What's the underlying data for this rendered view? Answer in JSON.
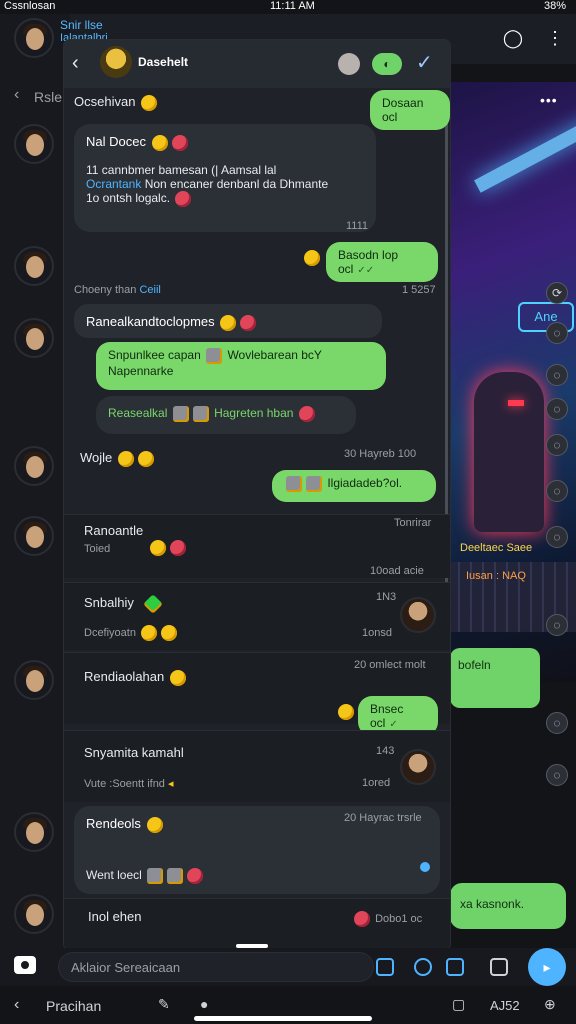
{
  "status": {
    "carrier": "Cssnlosan",
    "time": "11:11 AM",
    "battery": "38%"
  },
  "background": {
    "title": "Snir llse",
    "subtitle": "Ialantalbri",
    "back_label": "Rsle",
    "art_caption_1": "Deeltaec Saee",
    "art_caption_2": "Iusan : NAQ",
    "bubble_1": "bofeln",
    "bubble_2": "xa kasnonk."
  },
  "panel": {
    "title": "Dasehelt",
    "header_row_left": "Ocsehivan",
    "header_row_pill": "Dosaan ocl",
    "messages": [
      {
        "name": "Nal Docec",
        "body_line_1": "11  cannbmer bamesan (| Aamsal lal",
        "body_link": "Ocrantank",
        "body_line_2": " Non encaner denbanl da Dhmante",
        "body_line_3": "1o ontsh logalc.",
        "time": "1111"
      },
      {
        "out_text": "Basodn lop ocl"
      },
      {
        "meta_left": "Choeny than",
        "meta_link": "Ceiil",
        "meta_right": "1 5257"
      },
      {
        "title": "Ranealkandtoclopmes",
        "green_text_1": "Snpunlkee capan",
        "green_text_2": "Wovlebarean bcY",
        "green_text_3": "Napennarke",
        "sub_text_1": "Reasealkal",
        "sub_text_2": "Hagreten hban"
      },
      {
        "label": "Wojle",
        "time": "30 Hayreb 100"
      },
      {
        "out_text": "Ilgiadadeb?ol."
      },
      {
        "name": "Ranoantle",
        "sub": "Toied",
        "time_top": "Tonrirar",
        "time_bottom": "10oad acie"
      },
      {
        "name": "Snbalhiy",
        "sub": "Dcefiyoatn",
        "time_top": "1N3",
        "time_bottom": "1onsd"
      },
      {
        "name": "Rendiaolahan",
        "time": "20 omlect molt"
      },
      {
        "out_text": "Bnsec ocl"
      },
      {
        "name": "Snyamita kamahl",
        "sub": "Vute :Soentt ifnd",
        "time_top": "143",
        "time_bottom": "1ored"
      },
      {
        "name": "Rendeols",
        "sub": "Went loecl",
        "time": "20 Hayrac trsrle"
      },
      {
        "name": "Inol ehen",
        "time": "Dobo1 oc"
      }
    ]
  },
  "input": {
    "placeholder": "Aklaior Sereaicaan"
  },
  "nav": {
    "label": "Pracihan",
    "code": "AJ52"
  },
  "colors": {
    "accent": "#4fb4ff",
    "out_bubble": "#7ad86a",
    "panel_bg": "#1f2228"
  }
}
